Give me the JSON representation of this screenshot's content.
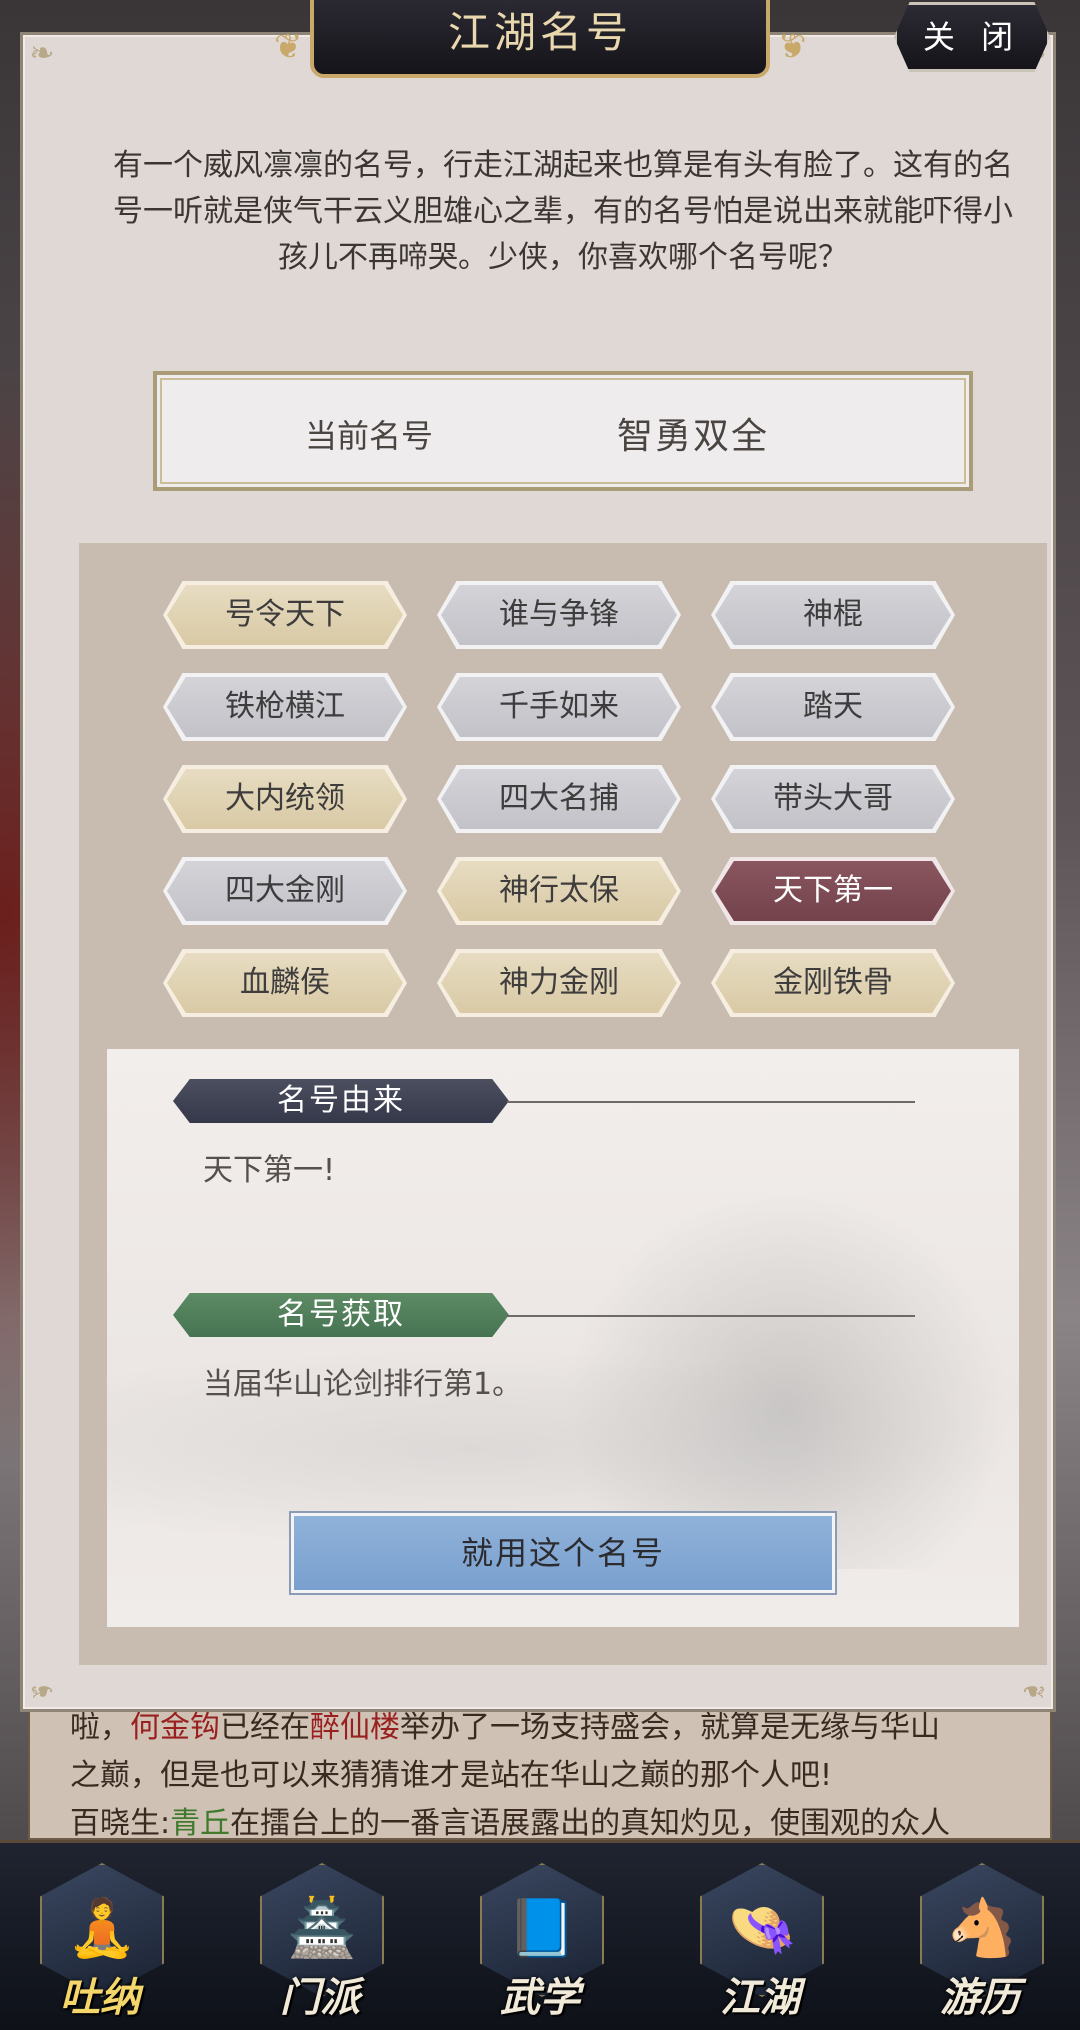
{
  "dialog": {
    "title": "江湖名号",
    "close_label": "关 闭",
    "intro": "有一个威风凛凛的名号，行走江湖起来也算是有头有脸了。这有的名号一听就是侠气干云义胆雄心之辈，有的名号怕是说出来就能吓得小孩儿不再啼哭。少侠，你喜欢哪个名号呢？",
    "current_label": "当前名号",
    "current_value": "智勇双全"
  },
  "titles": [
    {
      "label": "号令天下",
      "style": "gold"
    },
    {
      "label": "谁与争锋",
      "style": "gray"
    },
    {
      "label": "神棍",
      "style": "gray"
    },
    {
      "label": "铁枪横江",
      "style": "gray"
    },
    {
      "label": "千手如来",
      "style": "gray"
    },
    {
      "label": "踏天",
      "style": "gray"
    },
    {
      "label": "大内统领",
      "style": "gold"
    },
    {
      "label": "四大名捕",
      "style": "gray"
    },
    {
      "label": "带头大哥",
      "style": "gray"
    },
    {
      "label": "四大金刚",
      "style": "gray"
    },
    {
      "label": "神行太保",
      "style": "gold"
    },
    {
      "label": "天下第一",
      "style": "selected"
    },
    {
      "label": "血麟侯",
      "style": "gold"
    },
    {
      "label": "神力金刚",
      "style": "gold"
    },
    {
      "label": "金刚铁骨",
      "style": "gold"
    }
  ],
  "detail": {
    "origin_label": "名号由来",
    "origin_text": "天下第一!",
    "acquire_label": "名号获取",
    "acquire_text": "当届华山论剑排行第1。",
    "use_button": "就用这个名号"
  },
  "story": {
    "line1_a": "啦，",
    "line1_name": "何金钩",
    "line1_b": "已经在",
    "line1_place": "醉仙楼",
    "line1_c": "举办了一场支持盛会，就算是无缘与华山",
    "line2": "之巅，但是也可以来猜猜谁才是站在华山之巅的那个人吧!",
    "line3_a": "百晓生:",
    "line3_name": "青丘",
    "line3_b": "在擂台上的一番言语展露出的真知灼见，使围观的众人"
  },
  "nav": [
    {
      "label": "吐纳",
      "icon": "meditation-icon",
      "active": true
    },
    {
      "label": "门派",
      "icon": "sect-icon",
      "active": false
    },
    {
      "label": "武学",
      "icon": "scroll-icon",
      "active": false
    },
    {
      "label": "江湖",
      "icon": "straw-hat-icon",
      "active": false
    },
    {
      "label": "游历",
      "icon": "horse-icon",
      "active": false
    }
  ],
  "colors": {
    "selected_title": "#7d4a54",
    "gold_title": "#dfd1b1",
    "gray_title": "#c9c9ce",
    "use_button": "#84a8d4",
    "name_red": "#9a1f1f",
    "name_green": "#3f7a2d"
  }
}
